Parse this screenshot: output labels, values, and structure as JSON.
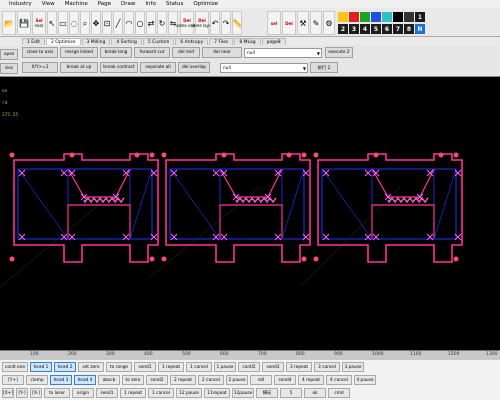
{
  "menu": [
    "Industry",
    "View",
    "Machine",
    "Page",
    "Draw",
    "Info",
    "Status",
    "Optimize"
  ],
  "toolbar": {
    "open_label": "Open",
    "save_label": "Save",
    "sel_near_label": "near",
    "sel_label": "Sel",
    "del_label": "Del",
    "del_same_color_label": "same color",
    "del_same_layer_label": "same layer",
    "sel_tb_label": "Sel",
    "color_squares": [
      {
        "text": "",
        "color": "#f5c518"
      },
      {
        "text": "",
        "color": "#e02020"
      },
      {
        "text": "",
        "color": "#20a020"
      },
      {
        "text": "",
        "color": "#2050e0"
      },
      {
        "text": "",
        "color": "#30c0c0"
      },
      {
        "text": "",
        "color": "#000000"
      },
      {
        "text": "",
        "color": "#333333"
      },
      {
        "text": "1",
        "color": "#1c1c1c"
      },
      {
        "text": "2",
        "color": "#1c1c1c"
      },
      {
        "text": "3",
        "color": "#1c1c1c"
      },
      {
        "text": "4",
        "color": "#1c1c1c"
      },
      {
        "text": "5",
        "color": "#1c1c1c"
      },
      {
        "text": "6",
        "color": "#1c1c1c"
      },
      {
        "text": "7",
        "color": "#1c1c1c"
      },
      {
        "text": "8",
        "color": "#1c1c1c"
      },
      {
        "text": "N",
        "color": "#1a6fd8"
      }
    ],
    "sel_label_2": "sel",
    "del_label_2": "Del",
    "icons": [
      "folder-open-icon",
      "save-icon",
      "select-icon",
      "delete-icon"
    ]
  },
  "tabs": [
    "1 Edit",
    "2 Optimize",
    "3 Milling",
    "4 Sorting",
    "5 Custom",
    "6 Antcopy",
    "7 Files",
    "8 MLog",
    "page8"
  ],
  "panel": {
    "row1": [
      "close to axis",
      "merge linked",
      "break long",
      "forward cut",
      "del mid",
      "del near"
    ],
    "row1_select": "null",
    "row1_right": "execute 2",
    "row2": [
      "X/Y>=1",
      "break at up",
      "break contract",
      "separate all",
      "del overlap"
    ],
    "row2_select": "null",
    "row2_right": "执行 2",
    "left_row1": "opse",
    "left_row2": "sies"
  },
  "coords": [
    "en",
    "",
    "rd",
    "272.55"
  ],
  "ruler": [
    "100",
    "200",
    "300",
    "400",
    "500",
    "600",
    "700",
    "800",
    "900",
    "1000",
    "1100",
    "1200",
    "1300"
  ],
  "bottom": {
    "row1": [
      "contl one",
      "head 1",
      "head 2",
      "set zero",
      "to range",
      "send1",
      "1 repeat",
      "1 cancel",
      "1 pause",
      "contl2",
      "send3",
      "3 repeat",
      "3 cancel",
      "3 pause"
    ],
    "row2": [
      "[Y+]",
      "clamp",
      "head 3",
      "head 4",
      "abscb",
      "to zero",
      "send2",
      "2 repeat",
      "2 cancel",
      "2 pause",
      "roll",
      "send4",
      "4 repeat",
      "4 cancel",
      "4 pause"
    ],
    "row3": [
      "[X+]",
      "[Y-]",
      "[X-]",
      "to laser",
      "origin",
      "send1",
      "1 repeat",
      "1 cancel",
      "12 pause",
      "11repeat",
      "12pause",
      "横向",
      "5",
      "ok",
      "cmd"
    ]
  },
  "accent_colors": {
    "shape": "#ff3399",
    "frame": "#2233ff",
    "mark": "#ff66cc"
  }
}
